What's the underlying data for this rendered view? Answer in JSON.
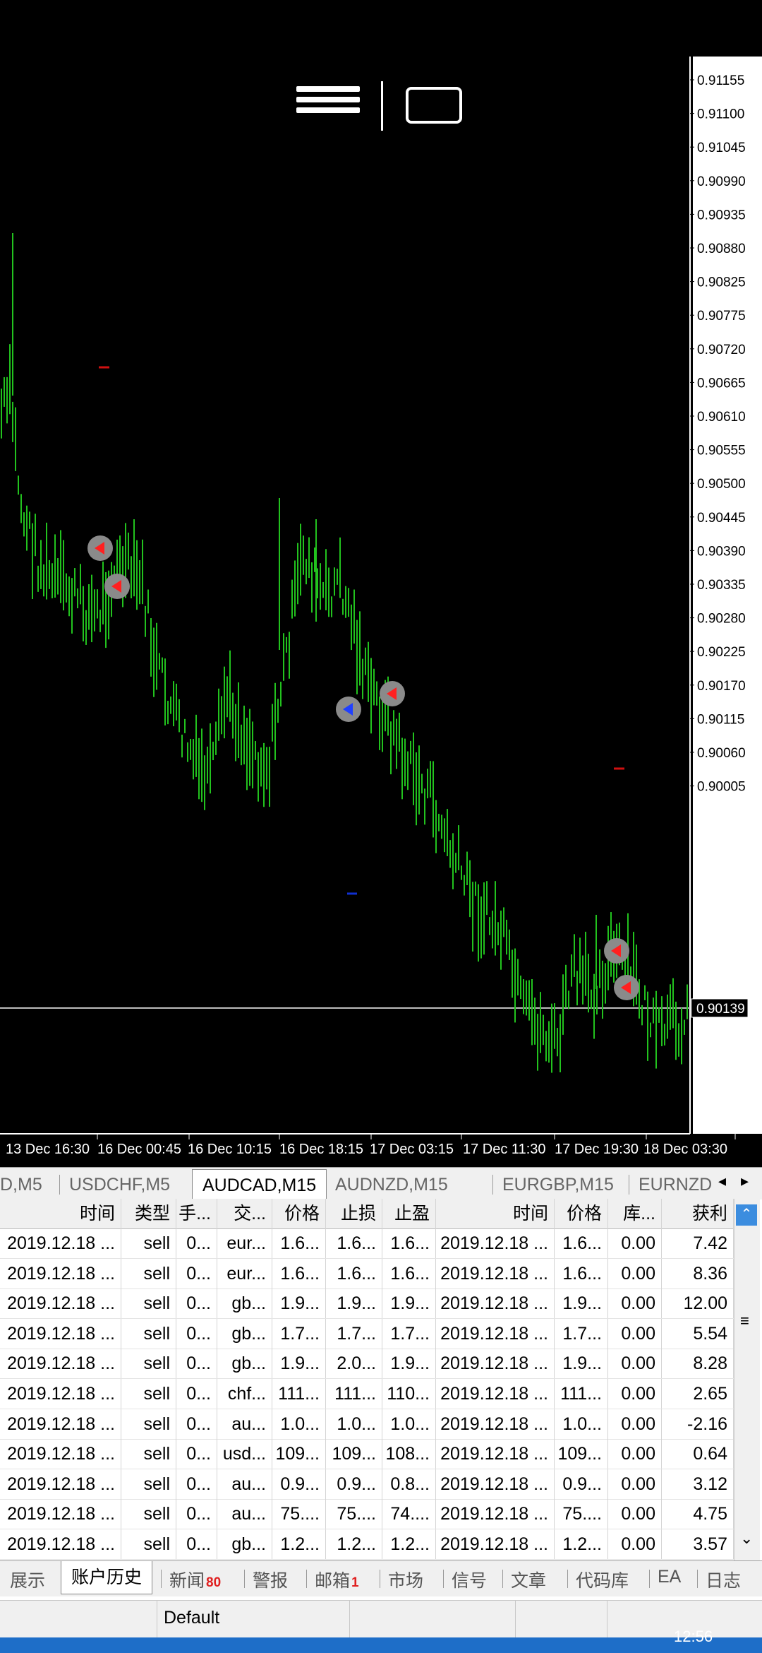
{
  "chart": {
    "symbol": "AUDCAD,M15",
    "current_price": "0.90139",
    "price_axis": [
      "0.91155",
      "0.91100",
      "0.91045",
      "0.90990",
      "0.90935",
      "0.90880",
      "0.90825",
      "0.90775",
      "0.90720",
      "0.90665",
      "0.90610",
      "0.90555",
      "0.90500",
      "0.90445",
      "0.90390",
      "0.90335",
      "0.90280",
      "0.90225",
      "0.90170",
      "0.90115",
      "0.90060",
      "0.90005"
    ],
    "time_axis": [
      "13 Dec 16:30",
      "16 Dec 00:45",
      "16 Dec 10:15",
      "16 Dec 18:15",
      "17 Dec 03:15",
      "17 Dec 11:30",
      "17 Dec 19:30",
      "18 Dec 03:30"
    ],
    "candle_color": "#22c21e",
    "background": "#000000"
  },
  "toolbar": {
    "menu_icon": "hamburger-menu-icon",
    "keyboard_icon": "keyboard-icon"
  },
  "symbol_tabs": [
    "D,M5",
    "USDCHF,M5",
    "AUDCAD,M15",
    "AUDNZD,M15",
    "EURGBP,M15",
    "EURNZD"
  ],
  "table": {
    "headers": [
      "时间",
      "类型",
      "手...",
      "交...",
      "价格",
      "止损",
      "止盈",
      "时间",
      "价格",
      "库...",
      "获利"
    ],
    "rows": [
      [
        "2019.12.18 ...",
        "sell",
        "0...",
        "eur...",
        "1.6...",
        "1.6...",
        "1.6...",
        "2019.12.18 ...",
        "1.6...",
        "0.00",
        "7.42"
      ],
      [
        "2019.12.18 ...",
        "sell",
        "0...",
        "eur...",
        "1.6...",
        "1.6...",
        "1.6...",
        "2019.12.18 ...",
        "1.6...",
        "0.00",
        "8.36"
      ],
      [
        "2019.12.18 ...",
        "sell",
        "0...",
        "gb...",
        "1.9...",
        "1.9...",
        "1.9...",
        "2019.12.18 ...",
        "1.9...",
        "0.00",
        "12.00"
      ],
      [
        "2019.12.18 ...",
        "sell",
        "0...",
        "gb...",
        "1.7...",
        "1.7...",
        "1.7...",
        "2019.12.18 ...",
        "1.7...",
        "0.00",
        "5.54"
      ],
      [
        "2019.12.18 ...",
        "sell",
        "0...",
        "gb...",
        "1.9...",
        "2.0...",
        "1.9...",
        "2019.12.18 ...",
        "1.9...",
        "0.00",
        "8.28"
      ],
      [
        "2019.12.18 ...",
        "sell",
        "0...",
        "chf...",
        "111...",
        "111...",
        "110...",
        "2019.12.18 ...",
        "111...",
        "0.00",
        "2.65"
      ],
      [
        "2019.12.18 ...",
        "sell",
        "0...",
        "au...",
        "1.0...",
        "1.0...",
        "1.0...",
        "2019.12.18 ...",
        "1.0...",
        "0.00",
        "-2.16"
      ],
      [
        "2019.12.18 ...",
        "sell",
        "0...",
        "usd...",
        "109...",
        "109...",
        "108...",
        "2019.12.18 ...",
        "109...",
        "0.00",
        "0.64"
      ],
      [
        "2019.12.18 ...",
        "sell",
        "0...",
        "au...",
        "0.9...",
        "0.9...",
        "0.8...",
        "2019.12.18 ...",
        "0.9...",
        "0.00",
        "3.12"
      ],
      [
        "2019.12.18 ...",
        "sell",
        "0...",
        "au...",
        "75....",
        "75....",
        "74....",
        "2019.12.18 ...",
        "75....",
        "0.00",
        "4.75"
      ],
      [
        "2019.12.18 ...",
        "sell",
        "0...",
        "gb...",
        "1.2...",
        "1.2...",
        "1.2...",
        "2019.12.18 ...",
        "1.2...",
        "0.00",
        "3.57"
      ]
    ]
  },
  "bottom_tabs": [
    {
      "label": "展示",
      "badge": ""
    },
    {
      "label": "账户历史",
      "badge": ""
    },
    {
      "label": "新闻",
      "badge": "80"
    },
    {
      "label": "警报",
      "badge": ""
    },
    {
      "label": "邮箱",
      "badge": "1"
    },
    {
      "label": "市场",
      "badge": ""
    },
    {
      "label": "信号",
      "badge": ""
    },
    {
      "label": "文章",
      "badge": ""
    },
    {
      "label": "代码库",
      "badge": ""
    },
    {
      "label": "EA",
      "badge": ""
    },
    {
      "label": "日志",
      "badge": ""
    }
  ],
  "status": {
    "profile": "Default",
    "clock": "12:56"
  }
}
